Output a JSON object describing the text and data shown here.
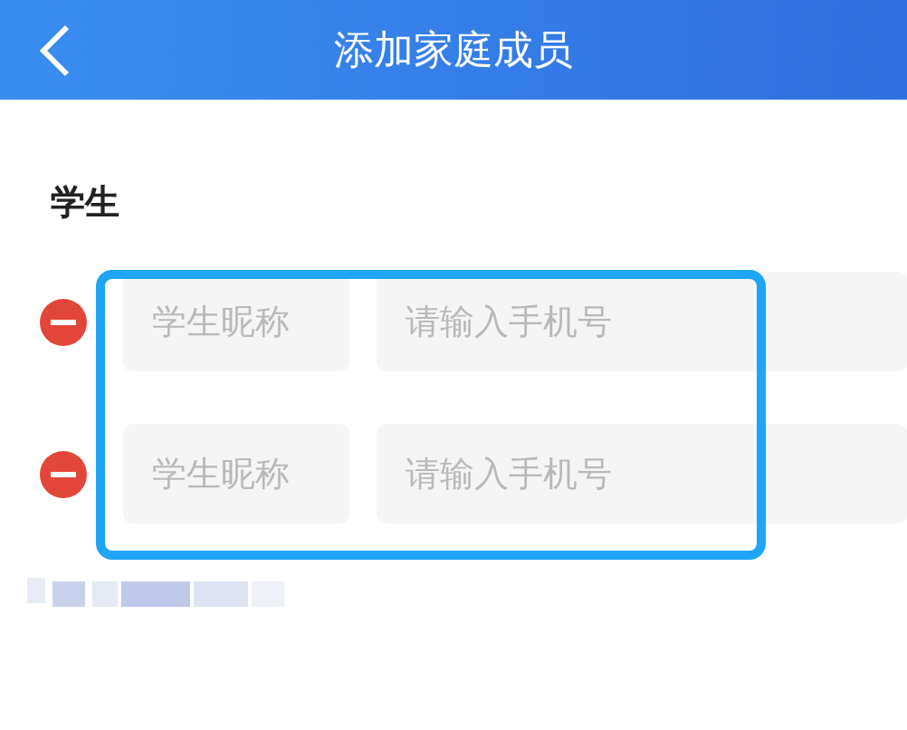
{
  "header": {
    "title": "添加家庭成员"
  },
  "section": {
    "label": "学生"
  },
  "rows": [
    {
      "nickname": {
        "placeholder": "学生昵称"
      },
      "phone": {
        "placeholder": "请输入手机号"
      }
    },
    {
      "nickname": {
        "placeholder": "学生昵称"
      },
      "phone": {
        "placeholder": "请输入手机号"
      }
    }
  ]
}
